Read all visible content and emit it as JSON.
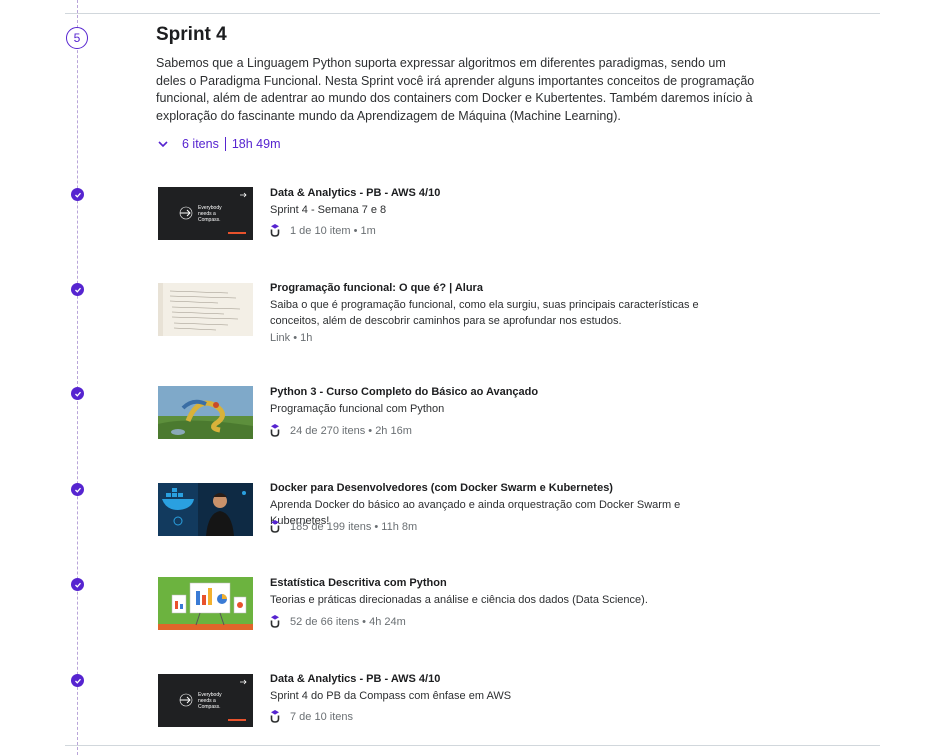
{
  "sprint": {
    "number": "5",
    "title": "Sprint 4",
    "description": "Sabemos que a Linguagem Python suporta expressar algoritmos em diferentes paradigmas, sendo um deles o Paradigma Funcional. Nesta Sprint você irá aprender alguns importantes conceitos de programação funcional, além de adentrar ao mundo dos containers com Docker e Kubertentes. Também daremos início à exploração do fascinante mundo da Aprendizagem de Máquina (Machine Learning).",
    "items_count": "6 itens",
    "duration": "18h 49m"
  },
  "items": [
    {
      "title": "Data & Analytics - PB - AWS 4/10",
      "subtitle": "Sprint 4 - Semana 7 e 8",
      "meta": "1 de 10 item • 1m",
      "thumb_text": "Everybody needs a Compass.",
      "icon": "udemy-icon"
    },
    {
      "title": "Programação funcional: O que é? | Alura",
      "subtitle": "Saiba o que é programação funcional, como ela surgiu, suas principais características e conceitos, além de descobrir caminhos para se aprofundar nos estudos.",
      "meta": "Link • 1h",
      "icon": ""
    },
    {
      "title": "Python 3 - Curso Completo do Básico ao Avançado",
      "subtitle": "Programação funcional com Python",
      "meta": "24 de 270 itens • 2h 16m",
      "icon": "udemy-icon"
    },
    {
      "title": "Docker para Desenvolvedores (com Docker Swarm e Kubernetes)",
      "subtitle": "Aprenda Docker do básico ao avançado e ainda orquestração com Docker Swarm e Kubernetes!",
      "meta": "185 de 199 itens • 11h 8m",
      "icon": "udemy-icon"
    },
    {
      "title": "Estatística Descritiva com Python",
      "subtitle": "Teorias e práticas direcionadas a análise e ciência dos dados (Data Science).",
      "meta": "52 de 66 itens • 4h 24m",
      "icon": "udemy-icon"
    },
    {
      "title": "Data & Analytics - PB - AWS 4/10",
      "subtitle": "Sprint 4 do PB da Compass com ênfase em AWS",
      "meta": "7 de 10 itens",
      "thumb_text": "Everybody needs a Compass.",
      "icon": "udemy-icon"
    }
  ],
  "colors": {
    "accent": "#5624d0",
    "text": "#1c1d1f",
    "muted": "#6a6f73"
  }
}
